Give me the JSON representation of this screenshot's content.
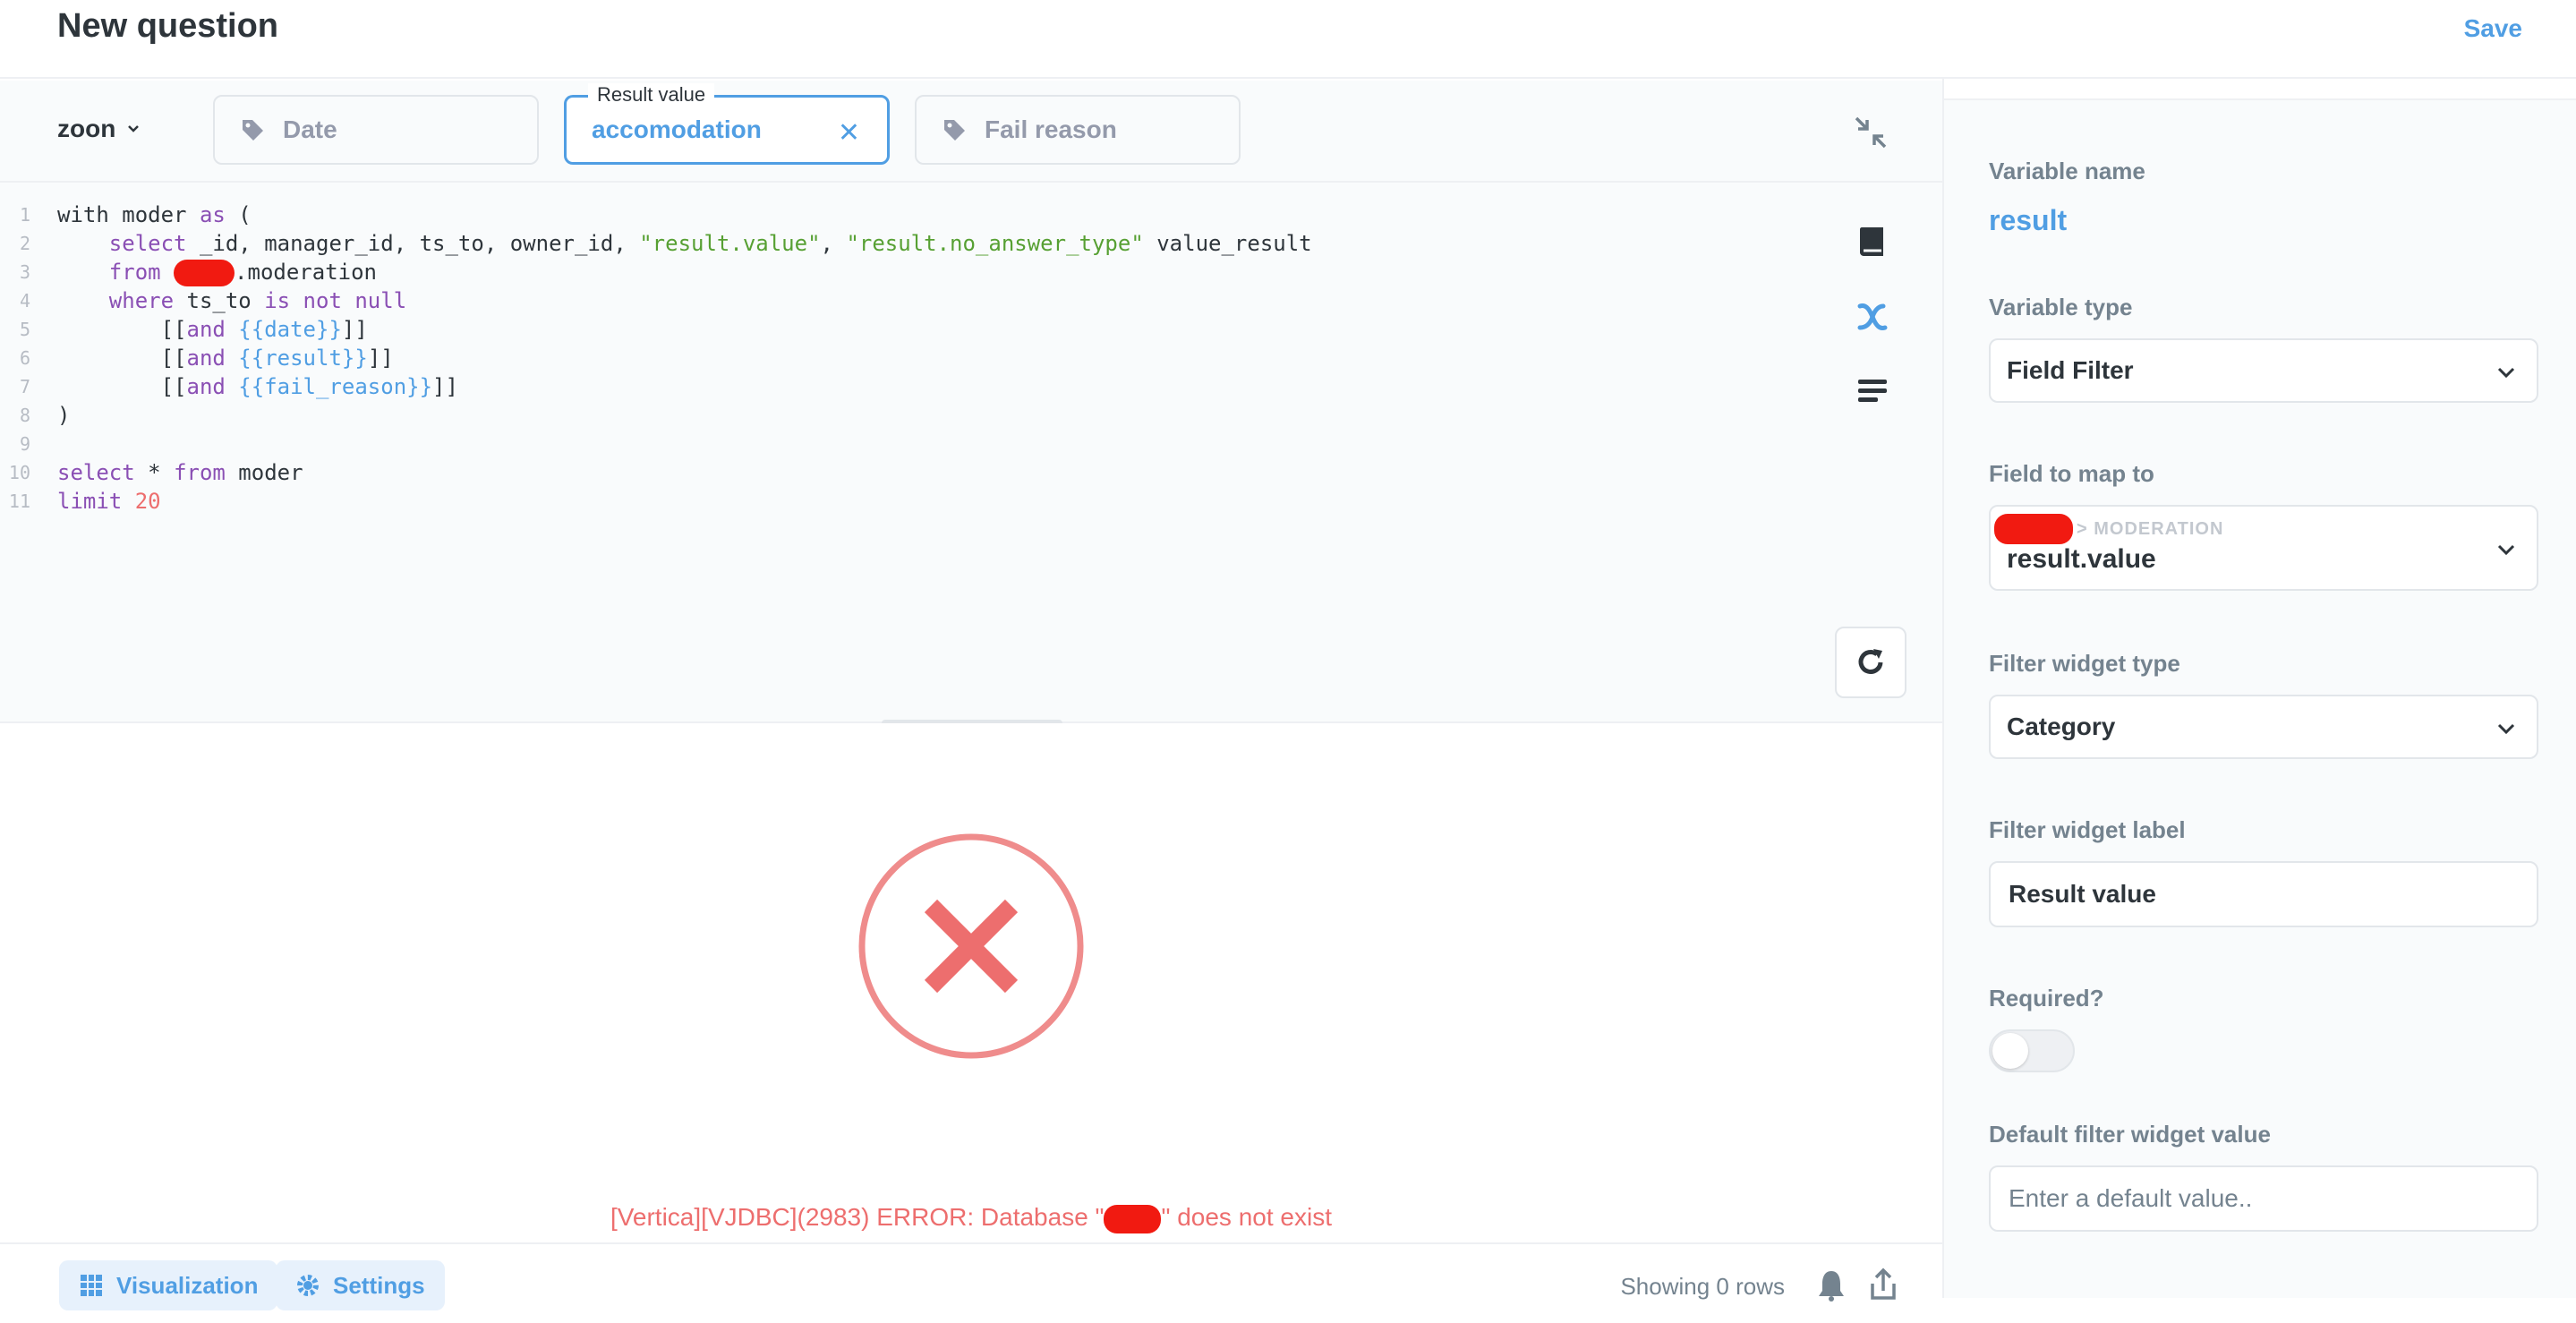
{
  "header": {
    "title": "New question",
    "save_label": "Save"
  },
  "params_bar": {
    "database": "zoon",
    "params": [
      {
        "label": "Date",
        "active": false
      },
      {
        "label": "Result value",
        "value": "accomodation",
        "active": true
      },
      {
        "label": "Fail reason",
        "active": false
      }
    ]
  },
  "editor": {
    "line_numbers": [
      "1",
      "2",
      "3",
      "4",
      "5",
      "6",
      "7",
      "8",
      "9",
      "10",
      "11"
    ],
    "l1": {
      "a": "with moder ",
      "kw": "as",
      "b": " ("
    },
    "l2": {
      "kw": "select",
      "a": " _id, manager_id, ts_to, owner_id, ",
      "s1": "\"result.value\"",
      "c": ", ",
      "s2": "\"result.no_answer_type\"",
      "d": " value_result"
    },
    "l3": {
      "kw": "from",
      "a": ".moderation"
    },
    "l4": {
      "kw": "where",
      "a": " ts_to ",
      "kw2": "is not null"
    },
    "l5": {
      "a": "[[",
      "kw": "and",
      "v": " {{date}}",
      "b": "]]"
    },
    "l6": {
      "a": "[[",
      "kw": "and",
      "v": " {{result}}",
      "b": "]]"
    },
    "l7": {
      "a": "[[",
      "kw": "and",
      "v": " {{fail_reason}}",
      "b": "]]"
    },
    "l8": {
      "a": ")"
    },
    "l10": {
      "kw": "select",
      "a": " * ",
      "kw2": "from",
      "b": " moder"
    },
    "l11": {
      "kw": "limit",
      "n": " 20"
    }
  },
  "error": {
    "prefix": "[Vertica][VJDBC](2983) ERROR: Database \"",
    "suffix": "\" does not exist"
  },
  "footer": {
    "visualization_label": "Visualization",
    "settings_label": "Settings",
    "showing": "Showing 0 rows"
  },
  "sidebar": {
    "variable_name_label": "Variable name",
    "variable_name": "result",
    "variable_type_label": "Variable type",
    "variable_type": "Field Filter",
    "field_map_label": "Field to map to",
    "field_table": "> MODERATION",
    "field_value": "result.value",
    "widget_type_label": "Filter widget type",
    "widget_type": "Category",
    "widget_label_label": "Filter widget label",
    "widget_label_value": "Result value",
    "required_label": "Required?",
    "default_label": "Default filter widget value",
    "default_placeholder": "Enter a default value.."
  },
  "colors": {
    "brand": "#509ee3",
    "error": "#ed6e6e",
    "redaction": "#f11a11"
  }
}
